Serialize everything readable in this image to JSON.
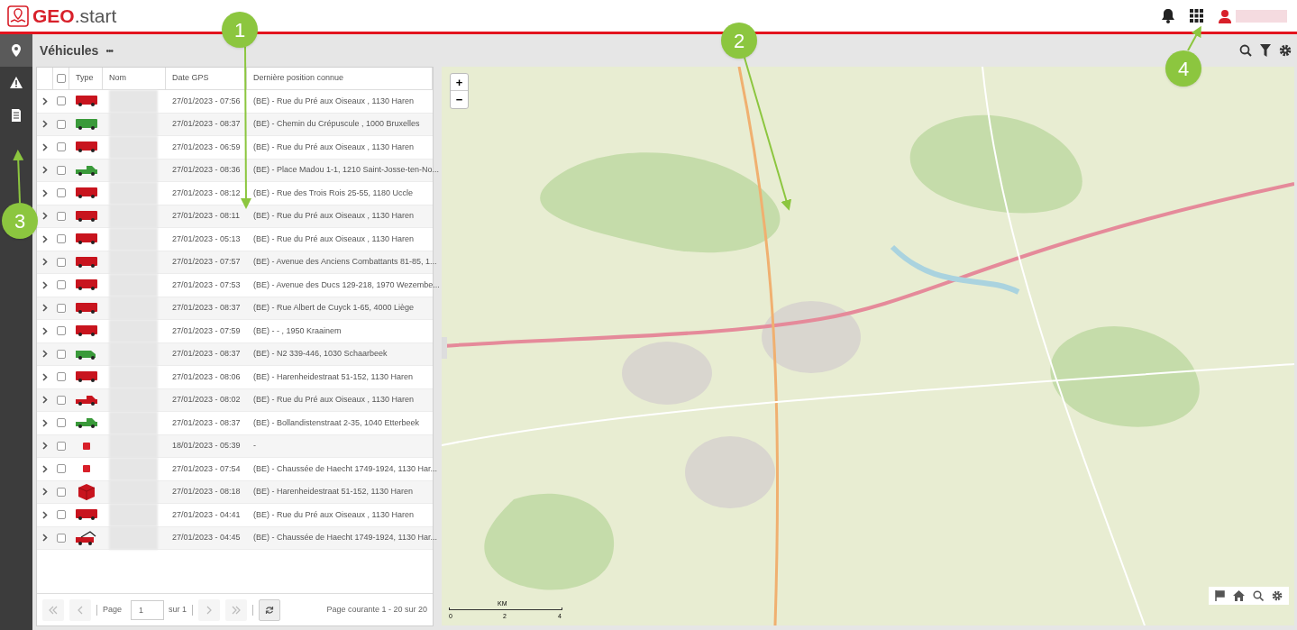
{
  "app": {
    "logo_bold": "GEO",
    "logo_rest": ".start"
  },
  "sidebar": {
    "items": [
      {
        "selected": true
      },
      {
        "selected": false
      },
      {
        "selected": false
      }
    ]
  },
  "panel": {
    "title": "Véhicules",
    "menu": "•••"
  },
  "table": {
    "select_all_checked": false,
    "columns": [
      "Type",
      "Nom",
      "Date GPS",
      "Dernière position connue"
    ],
    "rows": [
      {
        "kind": "truck",
        "color": "#c8141e",
        "checked": false,
        "date": "27/01/2023 - 07:56",
        "position": "(BE) - Rue du Pré aux Oiseaux , 1130 Haren"
      },
      {
        "kind": "truck",
        "color": "#3a9a3a",
        "checked": false,
        "date": "27/01/2023 - 08:37",
        "position": "(BE) - Chemin du Crépuscule , 1000 Bruxelles"
      },
      {
        "kind": "truck",
        "color": "#c8141e",
        "checked": false,
        "date": "27/01/2023 - 06:59",
        "position": "(BE) - Rue du Pré aux Oiseaux , 1130 Haren"
      },
      {
        "kind": "pickup",
        "color": "#3a9a3a",
        "checked": false,
        "date": "27/01/2023 - 08:36",
        "position": "(BE) - Place Madou 1-1, 1210 Saint-Josse-ten-No..."
      },
      {
        "kind": "truck",
        "color": "#c8141e",
        "checked": false,
        "date": "27/01/2023 - 08:12",
        "position": "(BE) - Rue des Trois Rois 25-55, 1180 Uccle"
      },
      {
        "kind": "truck",
        "color": "#c8141e",
        "checked": false,
        "date": "27/01/2023 - 08:11",
        "position": "(BE) - Rue du Pré aux Oiseaux , 1130 Haren"
      },
      {
        "kind": "truck",
        "color": "#c8141e",
        "checked": false,
        "date": "27/01/2023 - 05:13",
        "position": "(BE) - Rue du Pré aux Oiseaux , 1130 Haren"
      },
      {
        "kind": "truck",
        "color": "#c8141e",
        "checked": false,
        "date": "27/01/2023 - 07:57",
        "position": "(BE) - Avenue des Anciens Combattants 81-85, 1..."
      },
      {
        "kind": "truck",
        "color": "#c8141e",
        "checked": false,
        "date": "27/01/2023 - 07:53",
        "position": "(BE) - Avenue des Ducs 129-218, 1970 Wezembe..."
      },
      {
        "kind": "truck",
        "color": "#c8141e",
        "checked": false,
        "date": "27/01/2023 - 08:37",
        "position": "(BE) - Rue Albert de Cuyck 1-65, 4000 Liège"
      },
      {
        "kind": "truck",
        "color": "#c8141e",
        "checked": false,
        "date": "27/01/2023 - 07:59",
        "position": "(BE) - - , 1950 Kraainem"
      },
      {
        "kind": "van",
        "color": "#3a9a3a",
        "checked": false,
        "date": "27/01/2023 - 08:37",
        "position": "(BE) - N2 339-446, 1030 Schaarbeek"
      },
      {
        "kind": "truck",
        "color": "#c8141e",
        "checked": false,
        "date": "27/01/2023 - 08:06",
        "position": "(BE) - Harenheidestraat 51-152, 1130 Haren"
      },
      {
        "kind": "pickup",
        "color": "#c8141e",
        "checked": false,
        "date": "27/01/2023 - 08:02",
        "position": "(BE) - Rue du Pré aux Oiseaux , 1130 Haren"
      },
      {
        "kind": "pickup",
        "color": "#3a9a3a",
        "checked": false,
        "date": "27/01/2023 - 08:37",
        "position": "(BE) - Bollandistenstraat 2-35, 1040 Etterbeek"
      },
      {
        "kind": "square",
        "color": "#d8202a",
        "checked": false,
        "date": "18/01/2023 - 05:39",
        "position": "-"
      },
      {
        "kind": "square",
        "color": "#d8202a",
        "checked": false,
        "date": "27/01/2023 - 07:54",
        "position": "(BE) - Chaussée de Haecht 1749-1924, 1130 Har..."
      },
      {
        "kind": "box",
        "color": "#c8141e",
        "checked": false,
        "date": "27/01/2023 - 08:18",
        "position": "(BE) - Harenheidestraat 51-152, 1130 Haren"
      },
      {
        "kind": "truck",
        "color": "#c8141e",
        "checked": false,
        "date": "27/01/2023 - 04:41",
        "position": "(BE) - Rue du Pré aux Oiseaux , 1130 Haren"
      },
      {
        "kind": "crane",
        "color": "#c8141e",
        "checked": false,
        "date": "27/01/2023 - 04:45",
        "position": "(BE) - Chaussée de Haecht 1749-1924, 1130 Har..."
      }
    ]
  },
  "pager": {
    "page_label": "Page",
    "page": "1",
    "of": "sur 1",
    "summary": "Page courante 1 - 20 sur 20"
  },
  "map": {
    "zoom_in": "+",
    "zoom_out": "−",
    "scale_unit": "KM",
    "scale_ticks": [
      "0",
      "2",
      "4"
    ]
  },
  "callouts": [
    "1",
    "2",
    "3",
    "4"
  ]
}
